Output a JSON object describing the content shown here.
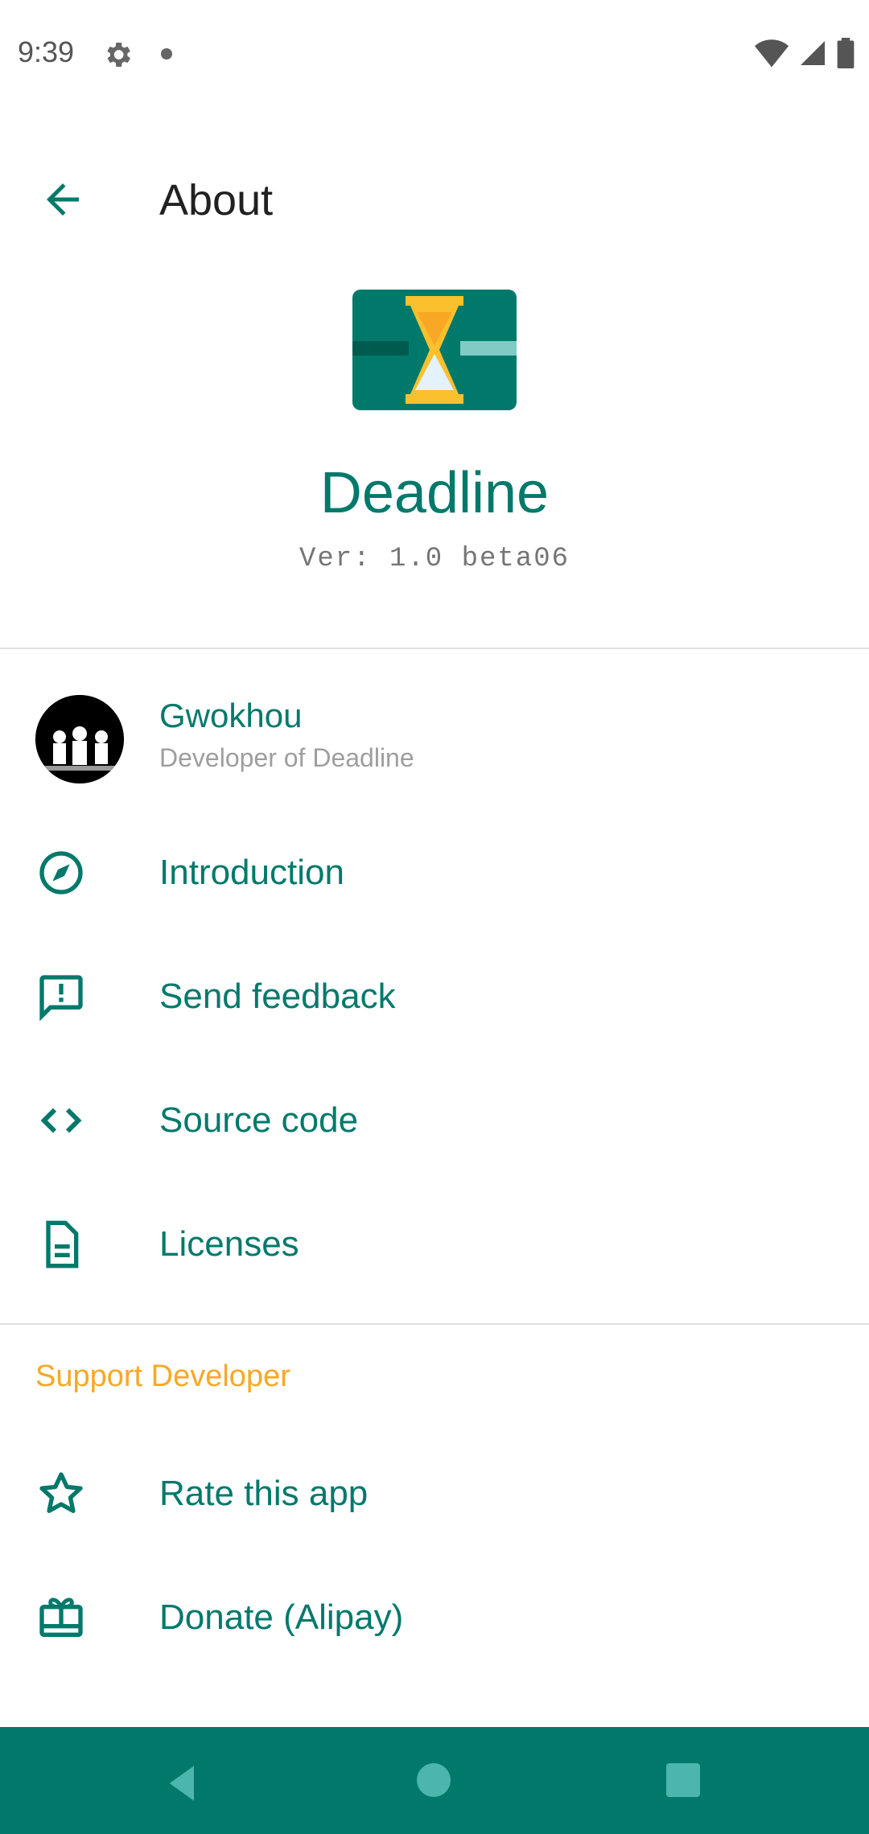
{
  "status_bar": {
    "time": "9:39"
  },
  "app_bar": {
    "title": "About"
  },
  "app_info": {
    "name": "Deadline",
    "version": "Ver: 1.0 beta06"
  },
  "developer": {
    "name": "Gwokhou",
    "subtitle": "Developer of Deadline"
  },
  "items": [
    {
      "label": "Introduction",
      "icon": "compass-icon"
    },
    {
      "label": "Send feedback",
      "icon": "feedback-icon"
    },
    {
      "label": "Source code",
      "icon": "code-icon"
    },
    {
      "label": "Licenses",
      "icon": "document-icon"
    }
  ],
  "support": {
    "header": "Support Developer",
    "items": [
      {
        "label": "Rate this app",
        "icon": "star-icon"
      },
      {
        "label": "Donate (Alipay)",
        "icon": "gift-card-icon"
      }
    ]
  },
  "colors": {
    "accent": "#00796b",
    "section_header": "#f9a825",
    "nav_bar": "#00796b"
  }
}
